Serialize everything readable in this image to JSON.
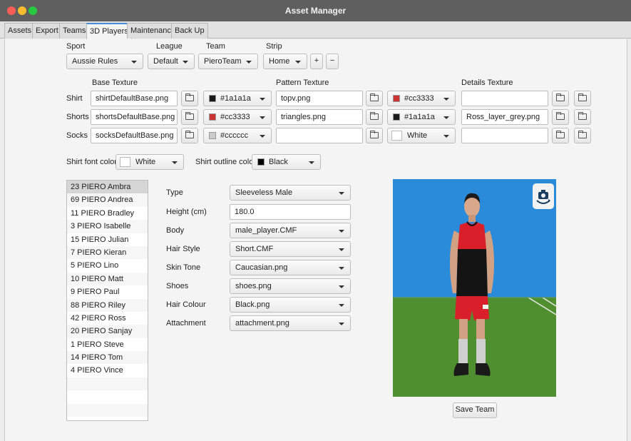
{
  "window": {
    "title": "Asset Manager"
  },
  "tabs": [
    {
      "label": "Assets"
    },
    {
      "label": "Export"
    },
    {
      "label": "Teams"
    },
    {
      "label": "3D Players",
      "active": true
    },
    {
      "label": "Maintenance"
    },
    {
      "label": "Back Up"
    }
  ],
  "selectors": {
    "sport": {
      "label": "Sport",
      "value": "Aussie Rules"
    },
    "league": {
      "label": "League",
      "value": "Default"
    },
    "team": {
      "label": "Team",
      "value": "PieroTeam"
    },
    "strip": {
      "label": "Strip",
      "value": "Home",
      "add_label": "+",
      "remove_label": "−"
    }
  },
  "texture_headers": {
    "base": "Base Texture",
    "pattern": "Pattern Texture",
    "details": "Details Texture"
  },
  "textures": [
    {
      "row": "Shirt",
      "base": "shirtDefaultBase.png",
      "base_color": "#1a1a1a",
      "base_swatch": "#1a1a1a",
      "pattern": "topv.png",
      "pattern_color": "#cc3333",
      "pattern_swatch": "#cc3333",
      "details": ""
    },
    {
      "row": "Shorts",
      "base": "shortsDefaultBase.png",
      "base_color": "#cc3333",
      "base_swatch": "#cc3333",
      "pattern": "triangles.png",
      "pattern_color": "#1a1a1a",
      "pattern_swatch": "#1a1a1a",
      "details": "Ross_layer_grey.png"
    },
    {
      "row": "Socks",
      "base": "socksDefaultBase.png",
      "base_color": "#cccccc",
      "base_swatch": "#cccccc",
      "pattern": "",
      "pattern_color": "White",
      "pattern_swatch": "#ffffff",
      "details": ""
    }
  ],
  "font_colors": {
    "font_label": "Shirt font color",
    "font_value": "White",
    "font_swatch": "#ffffff",
    "outline_label": "Shirt outline color",
    "outline_value": "Black",
    "outline_swatch": "#000000"
  },
  "players": [
    "23 PIERO Ambra",
    "69 PIERO Andrea",
    "11 PIERO Bradley",
    "3 PIERO Isabelle",
    "15 PIERO Julian",
    "7 PIERO Kieran",
    "5 PIERO Lino",
    "10 PIERO Matt",
    "9 PIERO Paul",
    "88 PIERO Riley",
    "42 PIERO Ross",
    "20 PIERO Sanjay",
    "1 PIERO Steve",
    "14 PIERO Tom",
    "4 PIERO Vince"
  ],
  "selected_player_index": 0,
  "player_form": [
    {
      "label": "Type",
      "value": "Sleeveless Male",
      "kind": "combo"
    },
    {
      "label": "Height (cm)",
      "value": "180.0",
      "kind": "field"
    },
    {
      "label": "Body",
      "value": "male_player.CMF",
      "kind": "combo"
    },
    {
      "label": "Hair Style",
      "value": "Short.CMF",
      "kind": "combo"
    },
    {
      "label": "Skin Tone",
      "value": "Caucasian.png",
      "kind": "combo"
    },
    {
      "label": "Shoes",
      "value": "shoes.png",
      "kind": "combo"
    },
    {
      "label": "Hair Colour",
      "value": "Black.png",
      "kind": "combo"
    },
    {
      "label": "Attachment",
      "value": "attachment.png",
      "kind": "combo"
    }
  ],
  "save_label": "Save Team",
  "icons": {
    "file_browse": "folder-icon",
    "camera": "camera-rotate-icon"
  }
}
